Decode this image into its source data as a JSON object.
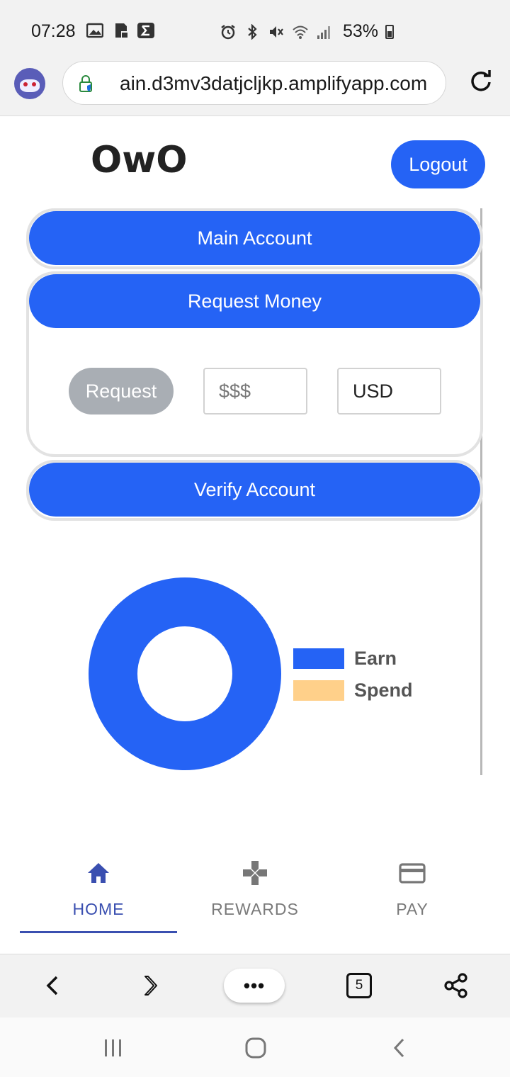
{
  "status_bar": {
    "time": "07:28",
    "battery": "53%",
    "icons_left": [
      "image-icon",
      "sd-card-icon",
      "sigma-icon"
    ],
    "icons_right": [
      "alarm-icon",
      "bluetooth-icon",
      "mute-icon",
      "wifi-icon",
      "signal-icon"
    ]
  },
  "browser": {
    "url": "ain.d3mv3datjcljkp.amplifyapp.com",
    "tab_count": "5",
    "more_label": "•••"
  },
  "app": {
    "title": "OwO",
    "logout_label": "Logout"
  },
  "accordion": {
    "main_account": "Main Account",
    "request_money": "Request Money",
    "verify_account": "Verify Account",
    "request_button": "Request",
    "amount_placeholder": "$$$",
    "currency_value": "USD"
  },
  "chart_data": {
    "type": "pie",
    "donut": true,
    "categories": [
      "Earn",
      "Spend"
    ],
    "values": [
      100,
      0
    ],
    "colors": [
      "#2563f5",
      "#ffd08a"
    ],
    "legend_position": "right"
  },
  "bottom_nav": {
    "items": [
      {
        "label": "HOME",
        "icon": "home-icon",
        "active": true
      },
      {
        "label": "REWARDS",
        "icon": "gamepad-icon",
        "active": false
      },
      {
        "label": "PAY",
        "icon": "credit-card-icon",
        "active": false
      }
    ]
  },
  "colors": {
    "primary": "#2563f5",
    "nav_active": "#3a4fb0",
    "disabled_button": "#a9aeb4"
  }
}
